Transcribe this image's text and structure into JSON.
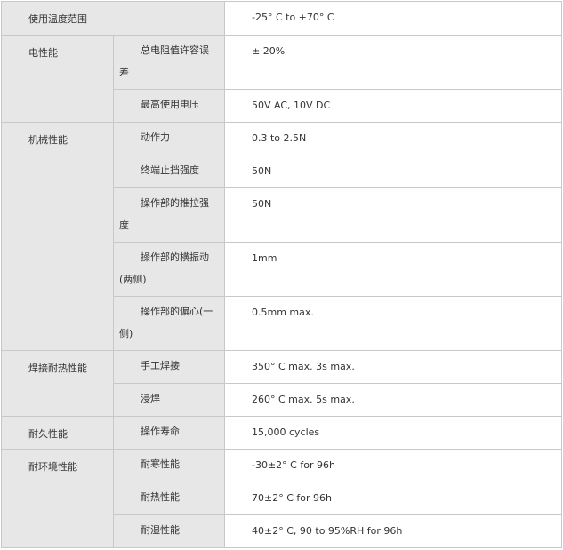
{
  "rows": {
    "temperature": {
      "category": "使用温度范围",
      "value": "-25° C to +70° C"
    },
    "electrical": {
      "category": "电性能",
      "items": [
        {
          "label": "总电阻值许容误差",
          "value": "± 20%"
        },
        {
          "label": "最高使用电压",
          "value": "50V AC, 10V DC"
        }
      ]
    },
    "mechanical": {
      "category": "机械性能",
      "items": [
        {
          "label": "动作力",
          "value": "0.3 to 2.5N"
        },
        {
          "label": "终端止挡强度",
          "value": "50N"
        },
        {
          "label": "操作部的推拉强度",
          "value": "50N"
        },
        {
          "label": "操作部的横振动(两侧)",
          "value": "1mm"
        },
        {
          "label": "操作部的偏心(一侧)",
          "value": "0.5mm max."
        }
      ]
    },
    "soldering": {
      "category": "焊接耐热性能",
      "items": [
        {
          "label": "手工焊接",
          "value": "350° C max. 3s max."
        },
        {
          "label": "浸焊",
          "value": "260° C max. 5s max."
        }
      ]
    },
    "durability": {
      "category": "耐久性能",
      "items": [
        {
          "label": "操作寿命",
          "value": "15,000 cycles"
        }
      ]
    },
    "environmental": {
      "category": "耐环境性能",
      "items": [
        {
          "label": "耐寒性能",
          "value": "-30±2° C for 96h"
        },
        {
          "label": "耐热性能",
          "value": "70±2° C for 96h"
        },
        {
          "label": "耐湿性能",
          "value": "40±2° C, 90 to 95%RH for 96h"
        }
      ]
    }
  }
}
